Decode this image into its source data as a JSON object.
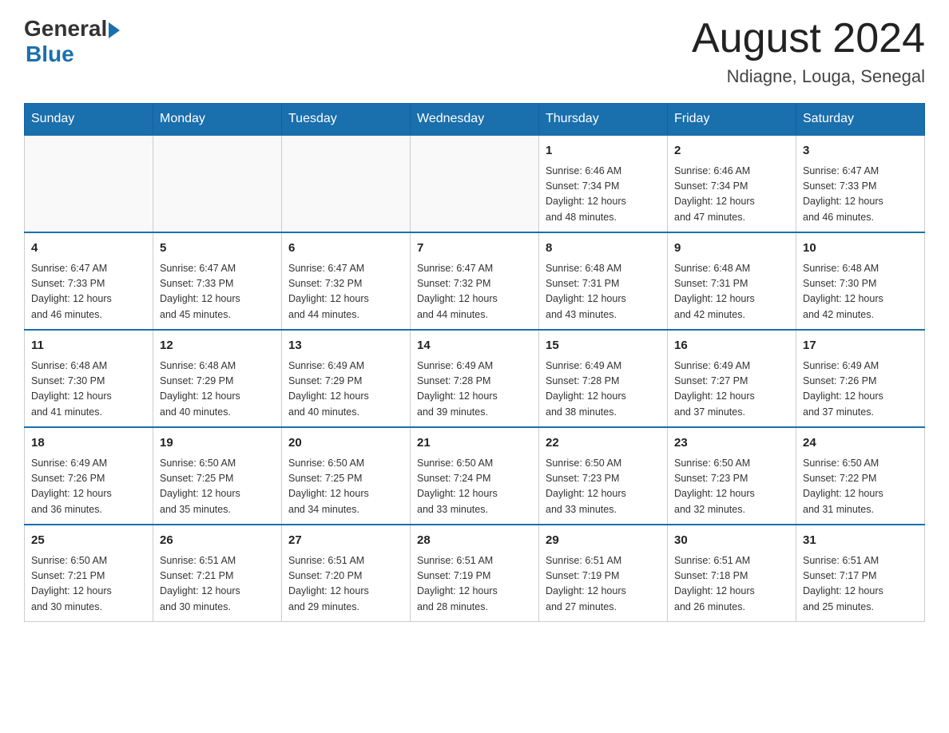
{
  "header": {
    "logo_general": "General",
    "logo_blue": "Blue",
    "main_title": "August 2024",
    "subtitle": "Ndiagne, Louga, Senegal"
  },
  "days_of_week": [
    "Sunday",
    "Monday",
    "Tuesday",
    "Wednesday",
    "Thursday",
    "Friday",
    "Saturday"
  ],
  "weeks": [
    [
      {
        "day": "",
        "info": ""
      },
      {
        "day": "",
        "info": ""
      },
      {
        "day": "",
        "info": ""
      },
      {
        "day": "",
        "info": ""
      },
      {
        "day": "1",
        "info": "Sunrise: 6:46 AM\nSunset: 7:34 PM\nDaylight: 12 hours\nand 48 minutes."
      },
      {
        "day": "2",
        "info": "Sunrise: 6:46 AM\nSunset: 7:34 PM\nDaylight: 12 hours\nand 47 minutes."
      },
      {
        "day": "3",
        "info": "Sunrise: 6:47 AM\nSunset: 7:33 PM\nDaylight: 12 hours\nand 46 minutes."
      }
    ],
    [
      {
        "day": "4",
        "info": "Sunrise: 6:47 AM\nSunset: 7:33 PM\nDaylight: 12 hours\nand 46 minutes."
      },
      {
        "day": "5",
        "info": "Sunrise: 6:47 AM\nSunset: 7:33 PM\nDaylight: 12 hours\nand 45 minutes."
      },
      {
        "day": "6",
        "info": "Sunrise: 6:47 AM\nSunset: 7:32 PM\nDaylight: 12 hours\nand 44 minutes."
      },
      {
        "day": "7",
        "info": "Sunrise: 6:47 AM\nSunset: 7:32 PM\nDaylight: 12 hours\nand 44 minutes."
      },
      {
        "day": "8",
        "info": "Sunrise: 6:48 AM\nSunset: 7:31 PM\nDaylight: 12 hours\nand 43 minutes."
      },
      {
        "day": "9",
        "info": "Sunrise: 6:48 AM\nSunset: 7:31 PM\nDaylight: 12 hours\nand 42 minutes."
      },
      {
        "day": "10",
        "info": "Sunrise: 6:48 AM\nSunset: 7:30 PM\nDaylight: 12 hours\nand 42 minutes."
      }
    ],
    [
      {
        "day": "11",
        "info": "Sunrise: 6:48 AM\nSunset: 7:30 PM\nDaylight: 12 hours\nand 41 minutes."
      },
      {
        "day": "12",
        "info": "Sunrise: 6:48 AM\nSunset: 7:29 PM\nDaylight: 12 hours\nand 40 minutes."
      },
      {
        "day": "13",
        "info": "Sunrise: 6:49 AM\nSunset: 7:29 PM\nDaylight: 12 hours\nand 40 minutes."
      },
      {
        "day": "14",
        "info": "Sunrise: 6:49 AM\nSunset: 7:28 PM\nDaylight: 12 hours\nand 39 minutes."
      },
      {
        "day": "15",
        "info": "Sunrise: 6:49 AM\nSunset: 7:28 PM\nDaylight: 12 hours\nand 38 minutes."
      },
      {
        "day": "16",
        "info": "Sunrise: 6:49 AM\nSunset: 7:27 PM\nDaylight: 12 hours\nand 37 minutes."
      },
      {
        "day": "17",
        "info": "Sunrise: 6:49 AM\nSunset: 7:26 PM\nDaylight: 12 hours\nand 37 minutes."
      }
    ],
    [
      {
        "day": "18",
        "info": "Sunrise: 6:49 AM\nSunset: 7:26 PM\nDaylight: 12 hours\nand 36 minutes."
      },
      {
        "day": "19",
        "info": "Sunrise: 6:50 AM\nSunset: 7:25 PM\nDaylight: 12 hours\nand 35 minutes."
      },
      {
        "day": "20",
        "info": "Sunrise: 6:50 AM\nSunset: 7:25 PM\nDaylight: 12 hours\nand 34 minutes."
      },
      {
        "day": "21",
        "info": "Sunrise: 6:50 AM\nSunset: 7:24 PM\nDaylight: 12 hours\nand 33 minutes."
      },
      {
        "day": "22",
        "info": "Sunrise: 6:50 AM\nSunset: 7:23 PM\nDaylight: 12 hours\nand 33 minutes."
      },
      {
        "day": "23",
        "info": "Sunrise: 6:50 AM\nSunset: 7:23 PM\nDaylight: 12 hours\nand 32 minutes."
      },
      {
        "day": "24",
        "info": "Sunrise: 6:50 AM\nSunset: 7:22 PM\nDaylight: 12 hours\nand 31 minutes."
      }
    ],
    [
      {
        "day": "25",
        "info": "Sunrise: 6:50 AM\nSunset: 7:21 PM\nDaylight: 12 hours\nand 30 minutes."
      },
      {
        "day": "26",
        "info": "Sunrise: 6:51 AM\nSunset: 7:21 PM\nDaylight: 12 hours\nand 30 minutes."
      },
      {
        "day": "27",
        "info": "Sunrise: 6:51 AM\nSunset: 7:20 PM\nDaylight: 12 hours\nand 29 minutes."
      },
      {
        "day": "28",
        "info": "Sunrise: 6:51 AM\nSunset: 7:19 PM\nDaylight: 12 hours\nand 28 minutes."
      },
      {
        "day": "29",
        "info": "Sunrise: 6:51 AM\nSunset: 7:19 PM\nDaylight: 12 hours\nand 27 minutes."
      },
      {
        "day": "30",
        "info": "Sunrise: 6:51 AM\nSunset: 7:18 PM\nDaylight: 12 hours\nand 26 minutes."
      },
      {
        "day": "31",
        "info": "Sunrise: 6:51 AM\nSunset: 7:17 PM\nDaylight: 12 hours\nand 25 minutes."
      }
    ]
  ]
}
